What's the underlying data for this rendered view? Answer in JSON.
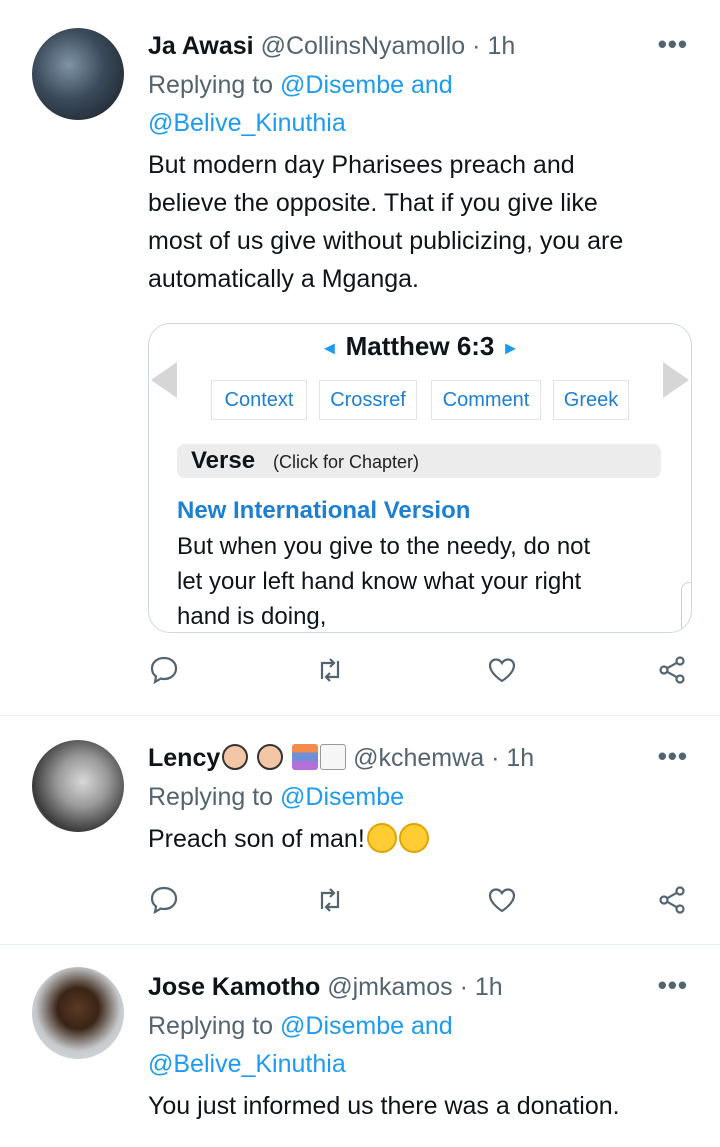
{
  "tweets": [
    {
      "name": "Ja Awasi",
      "handle": "@CollinsNyamollo",
      "dot": "·",
      "time": "1h",
      "replying_prefix": "Replying to",
      "mention1": "@Disembe and",
      "mention2": "@Belive_Kinuthia",
      "text_lines": [
        "But modern day Pharisees preach and",
        "believe the opposite. That if you give like",
        "most of us give without publicizing, you are",
        "automatically a Mganga."
      ],
      "card": {
        "title": "Matthew 6:3",
        "tabs": [
          "Context",
          "Crossref",
          "Comment",
          "Greek"
        ],
        "verse_label": "Verse",
        "verse_hint": "(Click for Chapter)",
        "version": "New International Version",
        "verse_lines": [
          "But when you give to the needy, do not",
          "let your left hand know what your right",
          "hand is doing,"
        ]
      }
    },
    {
      "name": "Lency",
      "emoji_names": [
        "woman-graduate-emoji",
        "man-graduate-emoji",
        "books-emoji",
        "memo-emoji"
      ],
      "handle": "@kchemwa",
      "dot": "·",
      "time": "1h",
      "replying_prefix": "Replying to",
      "mention1": "@Disembe",
      "text": "Preach son of man!",
      "text_emoji": [
        "rolling-laughing-emoji",
        "rolling-laughing-emoji"
      ]
    },
    {
      "name": "Jose Kamotho",
      "handle": "@jmkamos",
      "dot": "·",
      "time": "1h",
      "replying_prefix": "Replying to",
      "mention1": "@Disembe and",
      "mention2": "@Belive_Kinuthia",
      "text": "You just informed us there was a donation."
    }
  ],
  "more_label": "•••",
  "icons": [
    "reply-icon",
    "retweet-icon",
    "like-icon",
    "share-icon"
  ],
  "colors": {
    "link": "#1d9bf0",
    "secondary": "#536471",
    "text": "#0f1419",
    "card_link": "#1d7fd1"
  }
}
